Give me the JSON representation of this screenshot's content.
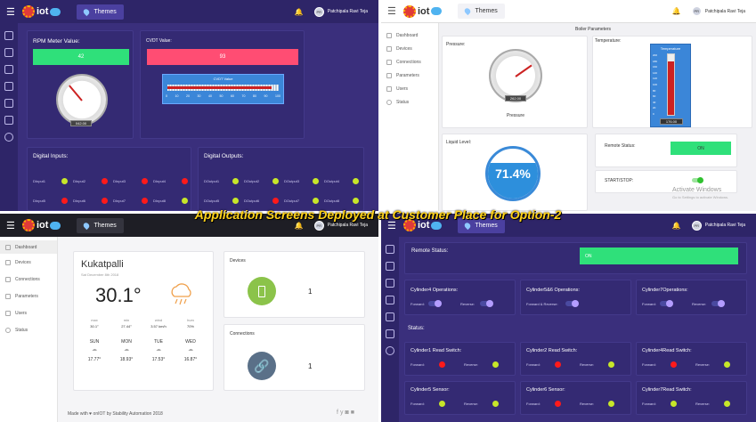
{
  "overlay_title": "Application Screens Deployed at Customer Place for Option-2",
  "header": {
    "app_name": "iot",
    "themes_label": "Themes",
    "user_name": "Patchipala Ravi Teja",
    "avatar_initials": "PR"
  },
  "q1": {
    "rpm_label": "RPM Meter Value:",
    "rpm_value": "42",
    "cvdt_label": "CVDT Value:",
    "cvdt_value": "93",
    "cvdt_inner_title": "CVDT Value",
    "cvdt_ticks": [
      "0",
      "10",
      "20",
      "30",
      "40",
      "50",
      "60",
      "70",
      "80",
      "90",
      "100"
    ],
    "gauge_readout": "042.00",
    "digital_inputs_label": "Digital Inputs:",
    "digital_outputs_label": "Digital Outputs:",
    "inputs": [
      {
        "name": "DInput1",
        "state": "on"
      },
      {
        "name": "DInput2",
        "state": "off"
      },
      {
        "name": "DInput3",
        "state": "off"
      },
      {
        "name": "DInput4",
        "state": "off"
      },
      {
        "name": "DInput5",
        "state": "off"
      },
      {
        "name": "DInput6",
        "state": "off"
      },
      {
        "name": "DInput7",
        "state": "off"
      },
      {
        "name": "DInput8",
        "state": "on"
      }
    ],
    "outputs": [
      {
        "name": "DOutput1",
        "state": "on"
      },
      {
        "name": "DOutput2",
        "state": "on"
      },
      {
        "name": "DOutput3",
        "state": "on"
      },
      {
        "name": "DOutput4",
        "state": "on"
      },
      {
        "name": "DOutput5",
        "state": "on"
      },
      {
        "name": "DOutput6",
        "state": "off"
      },
      {
        "name": "DOutput7",
        "state": "on"
      },
      {
        "name": "DOutput8",
        "state": "on"
      }
    ]
  },
  "sidebar": {
    "items": [
      "Dashboard",
      "Devices",
      "Connections",
      "Parameters",
      "Users",
      "Status"
    ]
  },
  "q2": {
    "section_title": "Boiler Parameters",
    "pressure_label": "Pressure:",
    "pressure_caption": "Pressure",
    "pressure_readout": "262.00",
    "temperature_label": "Temperature:",
    "thermo_title": "Temperature",
    "thermo_readout": "176.00",
    "thermo_scale": [
      "200",
      "180",
      "160",
      "140",
      "120",
      "100",
      "80",
      "60",
      "40",
      "20",
      "0"
    ],
    "liquid_label": "Liquid Level:",
    "liquid_value": "71.4%",
    "liquid_fill": 0.714,
    "remote_label": "Remote Status:",
    "remote_value": "ON",
    "startstop_label": "START/STOP:",
    "watermark_1": "Activate Windows",
    "watermark_2": "Go to Settings to activate Windows."
  },
  "q3": {
    "city": "Kukatpalli",
    "date": "Sat December 8th 2018",
    "temp": "30.1°",
    "metrics": [
      {
        "label": "max",
        "value": "30.1°"
      },
      {
        "label": "min",
        "value": "27.44°"
      },
      {
        "label": "wind",
        "value": "3.57 km/h"
      },
      {
        "label": "hum",
        "value": "70%"
      }
    ],
    "forecast": [
      {
        "day": "SUN",
        "temp": "17.77°"
      },
      {
        "day": "MON",
        "temp": "18.93°"
      },
      {
        "day": "TUE",
        "temp": "17.53°"
      },
      {
        "day": "WED",
        "temp": "16.87°"
      }
    ],
    "devices_label": "Devices",
    "devices_count": "1",
    "connections_label": "Connections",
    "connections_count": "1",
    "footer": "Made with ♥ onIOT by Stability Automation 2018"
  },
  "q4": {
    "remote_label": "Remote Status:",
    "remote_value": "ON",
    "ops": [
      {
        "title": "Cylinder4 Operations:",
        "opt_a": "Forward:",
        "opt_b": "Reverse:"
      },
      {
        "title": "Cylinder5&6 Operations:",
        "opt_a": "Forward & Reverse:",
        "opt_b": ""
      },
      {
        "title": "Cylinder7Operations:",
        "opt_a": "Forward:",
        "opt_b": "Reverse:"
      }
    ],
    "status_label": "Status:",
    "switches": [
      {
        "title": "Cylinder1 Read Switch:",
        "fwd": "Forward:",
        "rev": "Reverse:",
        "fwd_state": "off",
        "rev_state": "on"
      },
      {
        "title": "Cylinder2 Read Switch:",
        "fwd": "Forward:",
        "rev": "Reverse:",
        "fwd_state": "off",
        "rev_state": "on"
      },
      {
        "title": "Cylinder4Read Switch:",
        "fwd": "Forward:",
        "rev": "Reverse:",
        "fwd_state": "off",
        "rev_state": "on"
      }
    ],
    "sensors": [
      {
        "title": "Cylinder5 Sensor:",
        "fwd": "Forward:",
        "rev": "Reverse:",
        "fwd_state": "on",
        "rev_state": "on"
      },
      {
        "title": "Cylinder6 Sensor:",
        "fwd": "Forward:",
        "rev": "Reverse:",
        "fwd_state": "off",
        "rev_state": "on"
      },
      {
        "title": "Cylinder7Read Switch:",
        "fwd": "Forward:",
        "rev": "Reverse:",
        "fwd_state": "on",
        "rev_state": "on"
      }
    ]
  }
}
